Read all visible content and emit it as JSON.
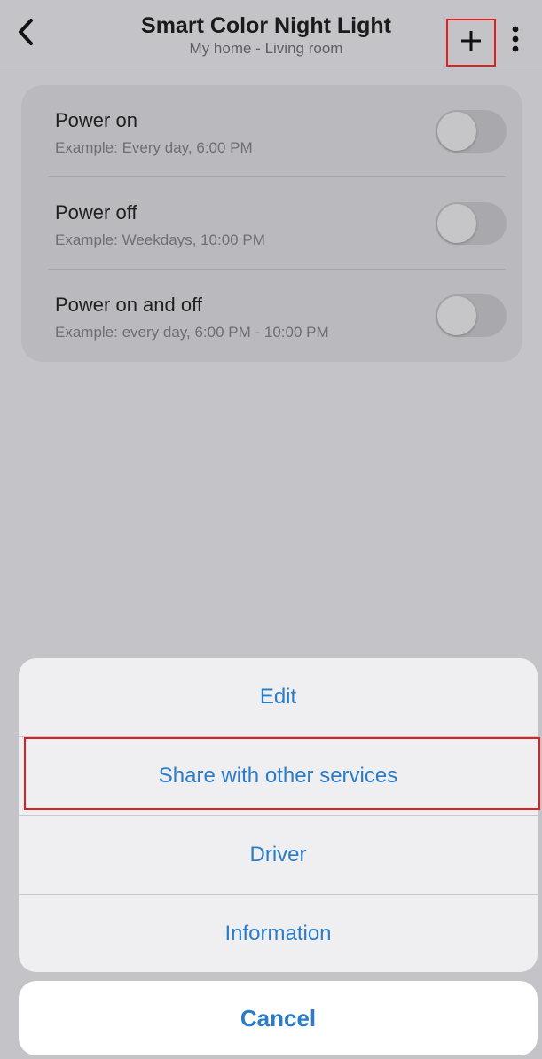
{
  "header": {
    "title": "Smart Color Night Light",
    "subtitle": "My home - Living room"
  },
  "schedules": [
    {
      "label": "Power on",
      "example": "Example: Every day, 6:00 PM",
      "enabled": false
    },
    {
      "label": "Power off",
      "example": "Example: Weekdays, 10:00 PM",
      "enabled": false
    },
    {
      "label": "Power on and off",
      "example": "Example: every day, 6:00 PM - 10:00 PM",
      "enabled": false
    }
  ],
  "action_sheet": {
    "items": [
      "Edit",
      "Share with other services",
      "Driver",
      "Information"
    ],
    "cancel_label": "Cancel"
  },
  "colors": {
    "accent": "#2a7cc7",
    "highlight_box": "#e02020"
  },
  "icons": {
    "back": "chevron-left-icon",
    "add": "plus-icon",
    "more": "vertical-ellipsis-icon"
  }
}
